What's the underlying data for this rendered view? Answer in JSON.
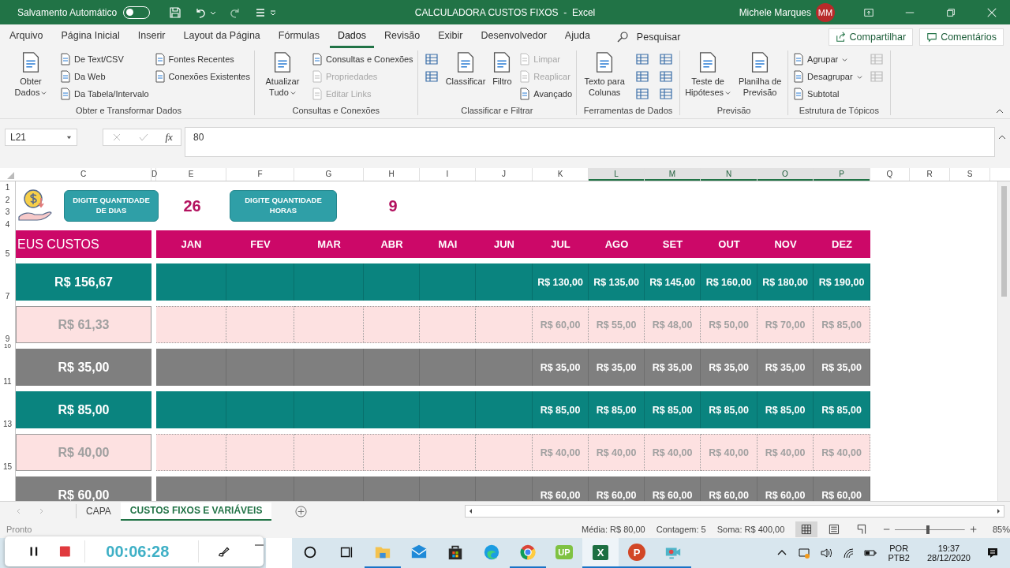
{
  "title_bar": {
    "autosave_label": "Salvamento Automático",
    "autosave_on": false,
    "title": "CALCULADORA CUSTOS FIXOS  -  Excel",
    "user": "Michele Marques",
    "avatar": "MM"
  },
  "ribbon_tabs": [
    {
      "label": "Arquivo",
      "selected": false
    },
    {
      "label": "Página Inicial",
      "selected": false
    },
    {
      "label": "Inserir",
      "selected": false
    },
    {
      "label": "Layout da Página",
      "selected": false
    },
    {
      "label": "Fórmulas",
      "selected": false
    },
    {
      "label": "Dados",
      "selected": true
    },
    {
      "label": "Revisão",
      "selected": false
    },
    {
      "label": "Exibir",
      "selected": false
    },
    {
      "label": "Desenvolvedor",
      "selected": false
    },
    {
      "label": "Ajuda",
      "selected": false
    }
  ],
  "search": {
    "placeholder": "Pesquisar"
  },
  "share_button": "Compartilhar",
  "comments_button": "Comentários",
  "ribbon_groups": [
    {
      "label": "Obter e Transformar Dados",
      "items": [
        {
          "kind": "large",
          "label": "Obter Dados",
          "dropdown": true,
          "disabled": false
        },
        {
          "kind": "small",
          "label": "De Text/CSV",
          "dropdown": false,
          "disabled": false
        },
        {
          "kind": "small",
          "label": "Da Web",
          "dropdown": false,
          "disabled": false
        },
        {
          "kind": "small",
          "label": "Da Tabela/Intervalo",
          "dropdown": false,
          "disabled": false
        },
        {
          "kind": "small",
          "label": "Fontes Recentes",
          "dropdown": false,
          "disabled": false
        },
        {
          "kind": "small",
          "label": "Conexões Existentes",
          "dropdown": false,
          "disabled": false
        }
      ]
    },
    {
      "label": "Consultas e Conexões",
      "items": [
        {
          "kind": "large",
          "label": "Atualizar Tudo",
          "dropdown": true,
          "disabled": false
        },
        {
          "kind": "small",
          "label": "Consultas e Conexões",
          "dropdown": false,
          "disabled": false
        },
        {
          "kind": "small",
          "label": "Propriedades",
          "dropdown": false,
          "disabled": true
        },
        {
          "kind": "small",
          "label": "Editar Links",
          "dropdown": false,
          "disabled": true
        }
      ]
    },
    {
      "label": "Classificar e Filtrar",
      "items": [
        {
          "kind": "icon",
          "disabled": false
        },
        {
          "kind": "icon",
          "disabled": false
        },
        {
          "kind": "large",
          "label": "Classificar",
          "dropdown": false,
          "disabled": false
        },
        {
          "kind": "large",
          "label": "Filtro",
          "dropdown": false,
          "disabled": false
        },
        {
          "kind": "small",
          "label": "Limpar",
          "dropdown": false,
          "disabled": true
        },
        {
          "kind": "small",
          "label": "Reaplicar",
          "dropdown": false,
          "disabled": true
        },
        {
          "kind": "small",
          "label": "Avançado",
          "dropdown": false,
          "disabled": false
        }
      ]
    },
    {
      "label": "Ferramentas de Dados",
      "items": [
        {
          "kind": "large",
          "label": "Texto para Colunas",
          "dropdown": false,
          "disabled": false
        },
        {
          "kind": "icon",
          "disabled": false
        },
        {
          "kind": "icon",
          "disabled": false
        },
        {
          "kind": "icon",
          "disabled": false
        },
        {
          "kind": "icon",
          "disabled": false
        },
        {
          "kind": "icon",
          "disabled": false
        },
        {
          "kind": "icon",
          "disabled": false
        }
      ]
    },
    {
      "label": "Previsão",
      "items": [
        {
          "kind": "large",
          "label": "Teste de Hipóteses",
          "dropdown": true,
          "disabled": false
        },
        {
          "kind": "large",
          "label": "Planilha de Previsão",
          "dropdown": false,
          "disabled": false
        }
      ]
    },
    {
      "label": "Estrutura de Tópicos",
      "items": [
        {
          "kind": "small",
          "label": "Agrupar",
          "dropdown": true,
          "disabled": false
        },
        {
          "kind": "small",
          "label": "Desagrupar",
          "dropdown": true,
          "disabled": false
        },
        {
          "kind": "small",
          "label": "Subtotal",
          "dropdown": false,
          "disabled": false
        },
        {
          "kind": "icon",
          "disabled": true
        },
        {
          "kind": "icon",
          "disabled": true
        }
      ]
    }
  ],
  "formula_bar": {
    "name_box": "L21",
    "fx": "fx",
    "value": "80"
  },
  "columns": [
    {
      "label": "C",
      "selected": false
    },
    {
      "label": "D",
      "selected": false
    },
    {
      "label": "E",
      "selected": false
    },
    {
      "label": "F",
      "selected": false
    },
    {
      "label": "G",
      "selected": false
    },
    {
      "label": "H",
      "selected": false
    },
    {
      "label": "I",
      "selected": false
    },
    {
      "label": "J",
      "selected": false
    },
    {
      "label": "K",
      "selected": false
    },
    {
      "label": "L",
      "selected": true
    },
    {
      "label": "M",
      "selected": true
    },
    {
      "label": "N",
      "selected": true
    },
    {
      "label": "O",
      "selected": true
    },
    {
      "label": "P",
      "selected": true
    },
    {
      "label": "Q",
      "selected": false
    },
    {
      "label": "R",
      "selected": false
    },
    {
      "label": "S",
      "selected": false
    }
  ],
  "top_rows": [
    "1",
    "2",
    "3",
    "4"
  ],
  "inputs": [
    {
      "label": "DIGITE QUANTIDADE DE DIAS",
      "value": "26"
    },
    {
      "label": "DIGITE QUANTIDADE HORAS",
      "value": "9"
    }
  ],
  "header_row": {
    "row_number": "5",
    "title": "EUS CUSTOS",
    "months": [
      "JAN",
      "FEV",
      "MAR",
      "ABR",
      "MAI",
      "JUN",
      "JUL",
      "AGO",
      "SET",
      "OUT",
      "NOV",
      "DEZ"
    ]
  },
  "rows": [
    {
      "kind": "teal",
      "row_number": "7",
      "total": "R$ 156,67",
      "values": [
        "R$ 130,00",
        "R$ 135,00",
        "R$ 145,00",
        "R$ 160,00",
        "R$ 180,00",
        "R$ 190,00"
      ]
    },
    {
      "kind": "pink",
      "row_number": "9",
      "gap_row_number": "10",
      "total": "R$ 61,33",
      "values": [
        "R$ 60,00",
        "R$ 55,00",
        "R$ 48,00",
        "R$ 50,00",
        "R$ 70,00",
        "R$ 85,00"
      ]
    },
    {
      "kind": "gray",
      "row_number": "11",
      "total": "R$ 35,00",
      "values": [
        "R$ 35,00",
        "R$ 35,00",
        "R$ 35,00",
        "R$ 35,00",
        "R$ 35,00",
        "R$ 35,00"
      ]
    },
    {
      "kind": "teal",
      "row_number": "13",
      "total": "R$ 85,00",
      "values": [
        "R$ 85,00",
        "R$ 85,00",
        "R$ 85,00",
        "R$ 85,00",
        "R$ 85,00",
        "R$ 85,00"
      ]
    },
    {
      "kind": "pink",
      "row_number": "15",
      "total": "R$ 40,00",
      "values": [
        "R$ 40,00",
        "R$ 40,00",
        "R$ 40,00",
        "R$ 40,00",
        "R$ 40,00",
        "R$ 40,00"
      ]
    },
    {
      "kind": "gray",
      "total": "R$ 60,00",
      "values": [
        "R$ 60,00",
        "R$ 60,00",
        "R$ 60,00",
        "R$ 60,00",
        "R$ 60,00",
        "R$ 60,00"
      ]
    }
  ],
  "sheet_tabs": [
    {
      "label": "CAPA",
      "selected": false
    },
    {
      "label": "CUSTOS FIXOS E VARIÁVEIS",
      "selected": true
    }
  ],
  "status_bar": {
    "state": "Pronto",
    "average": "Média: R$ 80,00",
    "count": "Contagem: 5",
    "sum": "Soma: R$ 400,00",
    "views": [
      {
        "selected": true
      },
      {
        "selected": false
      },
      {
        "selected": false
      }
    ],
    "zoom": {
      "level": 0.45
    },
    "zoom_label": "85%"
  },
  "taskbar": {
    "apps": [
      {
        "kind": "cortana",
        "running": false,
        "selected": false
      },
      {
        "kind": "taskview",
        "running": false,
        "selected": false
      },
      {
        "kind": "folder",
        "running": true,
        "selected": false
      },
      {
        "kind": "mail",
        "running": false,
        "selected": false
      },
      {
        "kind": "store",
        "running": false,
        "selected": false
      },
      {
        "kind": "edge",
        "running": false,
        "selected": false
      },
      {
        "kind": "chrome",
        "running": true,
        "selected": false
      },
      {
        "kind": "up",
        "glyph": "UP",
        "running": false,
        "selected": false
      },
      {
        "kind": "excel",
        "glyph": "X",
        "running": true,
        "selected": true
      },
      {
        "kind": "powerpoint",
        "glyph": "P",
        "running": true,
        "selected": false
      },
      {
        "kind": "camera",
        "running": true,
        "selected": false
      }
    ],
    "language": "POR",
    "layout": "PTB2",
    "time": "19:37",
    "date": "28/12/2020"
  },
  "recorder": {
    "time": "00:06:28"
  }
}
